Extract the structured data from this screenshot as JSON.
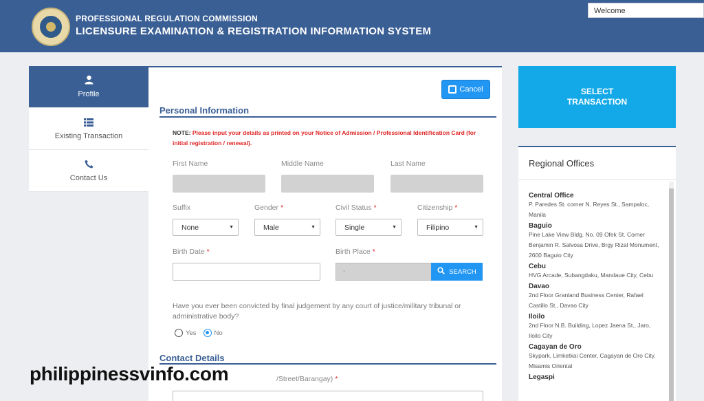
{
  "header": {
    "org_name": "PROFESSIONAL REGULATION COMMISSION",
    "system_name": "LICENSURE EXAMINATION & REGISTRATION INFORMATION SYSTEM",
    "welcome": "Welcome",
    "brand_color": "#3a5f95"
  },
  "nav": {
    "items": [
      {
        "label": "Profile",
        "icon": "user-icon",
        "active": true
      },
      {
        "label": "Existing Transaction",
        "icon": "list-icon",
        "active": false
      },
      {
        "label": "Contact Us",
        "icon": "phone-icon",
        "active": false
      }
    ]
  },
  "form": {
    "cancel_label": "Cancel",
    "personal_title": "Personal Information",
    "note_label": "NOTE:",
    "note_text": "Please input your details as printed on your Notice of Admission / Professional Identification Card (for initial registration / renewal).",
    "fields": {
      "first_name": "First Name",
      "middle_name": "Middle Name",
      "last_name": "Last Name",
      "suffix": "Suffix",
      "gender": "Gender",
      "civil_status": "Civil Status",
      "citizenship": "Citizenship",
      "birth_date": "Birth Date",
      "birth_place": "Birth Place"
    },
    "required_mark": "*",
    "values": {
      "suffix": "None",
      "gender": "Male",
      "civil_status": "Single",
      "citizenship": "Filipino",
      "birth_place": "-"
    },
    "search_label": "SEARCH",
    "question": "Have you ever been convicted by final judgement by any court of justice/military tribunal or administrative body?",
    "radio_yes": "Yes",
    "radio_no": "No",
    "selected_answer": "No",
    "contact_title": "Contact Details",
    "address_label": "/Street/Barangay)",
    "accent_color": "#2196f3"
  },
  "sidebar": {
    "select_transaction": "SELECT TRANSACTION",
    "regional_title": "Regional Offices",
    "offices": [
      {
        "name": "Central Office",
        "address": "P. Paredes St. corner N. Reyes St., Sampaloc, Manila"
      },
      {
        "name": "Baguio",
        "address": "Pine Lake View Bldg. No. 09 Ofek St. Corner Benjamin R. Salvosa Drive, Brgy Rizal Monument, 2600 Baguio City"
      },
      {
        "name": "Cebu",
        "address": "HVG Arcade, Subangdaku, Mandaue City, Cebu"
      },
      {
        "name": "Davao",
        "address": "2nd Floor Granland Business Center, Rafael Castillo St., Davao City"
      },
      {
        "name": "Iloilo",
        "address": "2nd Floor N.B. Building, Lopez Jaena St., Jaro, Iloilo City"
      },
      {
        "name": "Cagayan de Oro",
        "address": "Skypark, Limketkai Center, Cagayan de Oro City, Misamis Oriental"
      },
      {
        "name": "Legaspi",
        "address": ""
      }
    ]
  },
  "watermark": "philippinessvinfo.com"
}
